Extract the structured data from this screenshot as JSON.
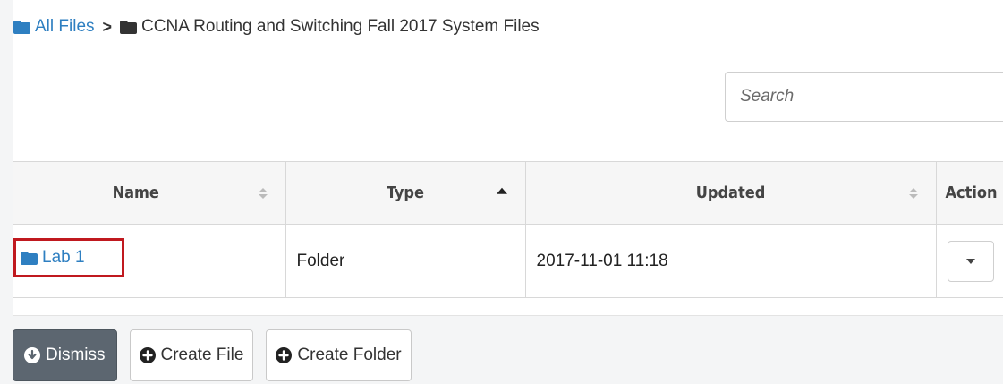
{
  "breadcrumb": {
    "root_label": "All Files",
    "separator": ">",
    "current_label": "CCNA Routing and Switching Fall 2017 System Files"
  },
  "search": {
    "placeholder": "Search",
    "value": ""
  },
  "table": {
    "columns": [
      {
        "label": "Name",
        "sort": "none"
      },
      {
        "label": "Type",
        "sort": "ascending"
      },
      {
        "label": "Updated",
        "sort": "none"
      },
      {
        "label": "Action",
        "sort": "none"
      }
    ],
    "rows": [
      {
        "name": "Lab 1",
        "type": "Folder",
        "updated": "2017-11-01 11:18"
      }
    ]
  },
  "footer": {
    "dismiss_label": "Dismiss",
    "create_file_label": "Create File",
    "create_folder_label": "Create Folder"
  },
  "icons": {
    "folder": "folder-icon",
    "dismiss": "arrow-down-circle-icon",
    "create": "plus-circle-icon",
    "action": "caret-down-icon"
  },
  "colors": {
    "link": "#2e7fc1",
    "highlight_box": "#c0191f",
    "dismiss_bg": "#5c6670",
    "dark_folder": "#333333"
  }
}
